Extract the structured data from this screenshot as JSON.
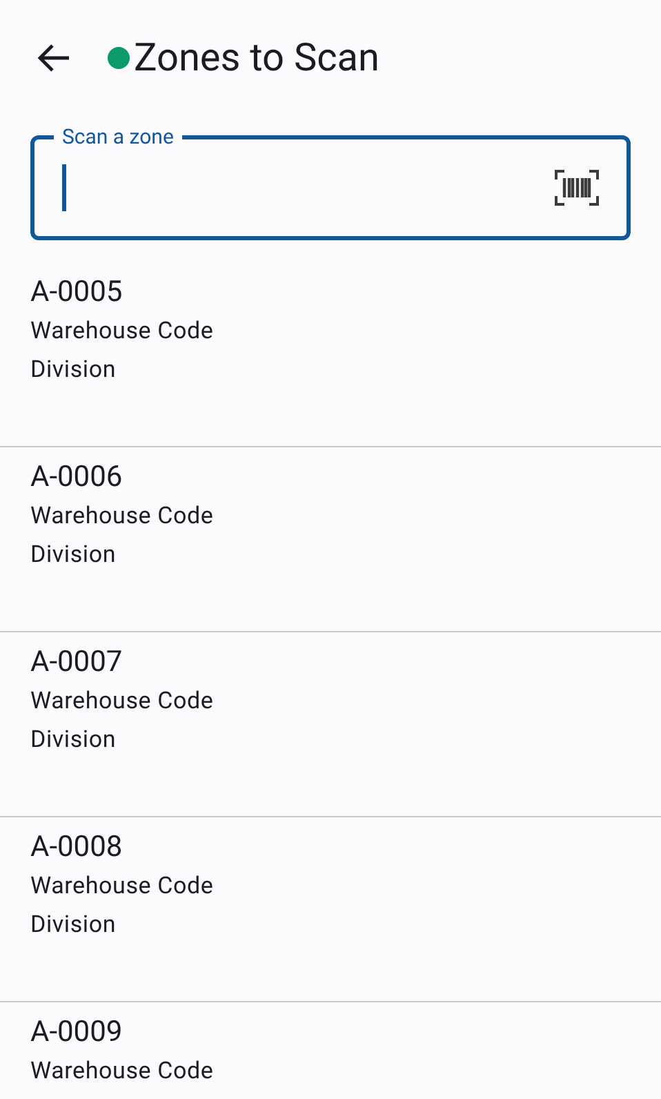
{
  "header": {
    "title": "Zones to Scan",
    "connected": true
  },
  "scan_field": {
    "label": "Scan a zone",
    "focused": true
  },
  "zones": [
    {
      "code": "A-0005",
      "lines": [
        "Warehouse Code",
        "Division"
      ]
    },
    {
      "code": "A-0006",
      "lines": [
        "Warehouse Code",
        "Division"
      ]
    },
    {
      "code": "A-0007",
      "lines": [
        "Warehouse Code",
        "Division"
      ]
    },
    {
      "code": "A-0008",
      "lines": [
        "Warehouse Code",
        "Division"
      ]
    },
    {
      "code": "A-0009",
      "lines": [
        "Warehouse Code"
      ]
    }
  ]
}
